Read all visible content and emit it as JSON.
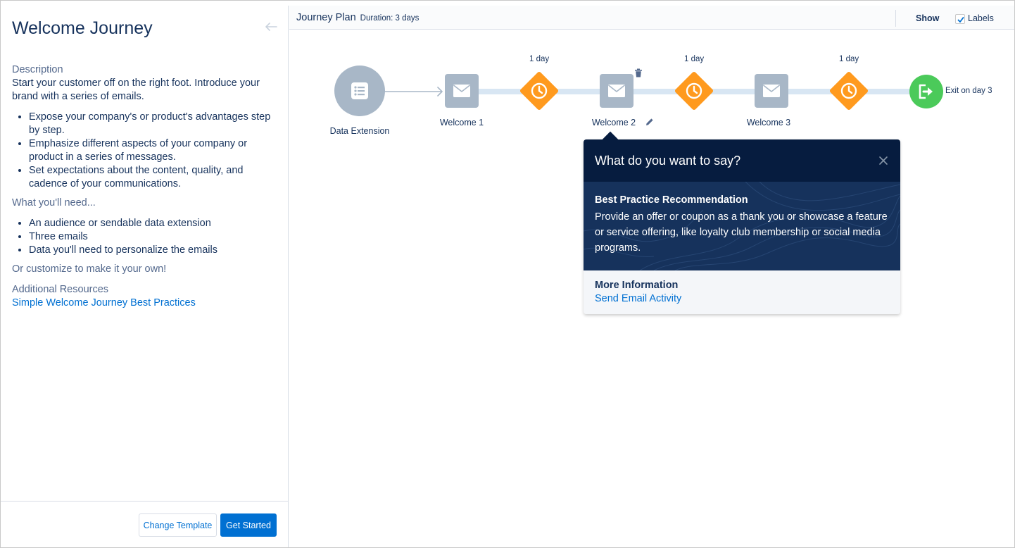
{
  "left_panel": {
    "title": "Welcome Journey",
    "description_label": "Description",
    "description_text": "Start your customer off on the right foot. Introduce your brand with a series of emails.",
    "bullets": [
      "Expose your company's or product's advantages step by step.",
      "Emphasize different aspects of your company or product in a series of messages.",
      "Set expectations about the content, quality, and cadence of your communications."
    ],
    "needs_label": "What you'll need...",
    "needs": [
      "An audience or sendable data extension",
      "Three emails",
      "Data you'll need to personalize the emails"
    ],
    "customize_text": "Or customize to make it your own!",
    "resources_label": "Additional Resources",
    "resource_link": "Simple Welcome Journey Best Practices",
    "change_template_label": "Change Template",
    "get_started_label": "Get Started"
  },
  "header": {
    "title": "Journey Plan",
    "duration": "Duration: 3 days",
    "show_label": "Show",
    "labels_checkbox": "Labels",
    "labels_checked": true
  },
  "canvas": {
    "entry_label": "Data Extension",
    "emails": [
      "Welcome 1",
      "Welcome 2",
      "Welcome 3"
    ],
    "waits": [
      "1 day",
      "1 day",
      "1 day"
    ],
    "exit_label": "Exit on day 3"
  },
  "popover": {
    "title": "What do you want to say?",
    "rec_title": "Best Practice Recommendation",
    "rec_text": "Provide an offer or coupon as a thank you or showcase a feature or service offering, like loyalty club membership or social media programs.",
    "more_label": "More Information",
    "more_link": "Send Email Activity"
  },
  "colors": {
    "brand": "#0070d2",
    "navy": "#16325c",
    "wait": "#ff9a1e",
    "exit": "#4bca5a",
    "email_node": "#a8b7c7",
    "track": "#d8e6f3"
  }
}
